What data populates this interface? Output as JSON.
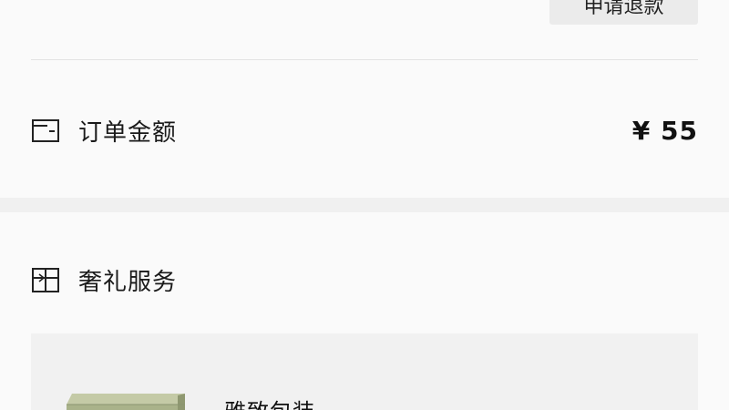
{
  "order": {
    "refund_button": "申请退款",
    "amount_label": "订单金额",
    "amount_value": "¥ 55"
  },
  "services": {
    "title": "奢礼服务",
    "items": [
      {
        "name": "雅致包装",
        "icon": "gift-box-image"
      }
    ]
  },
  "icons": {
    "amount": "wallet-icon",
    "services": "gift-icon"
  },
  "colors": {
    "background": "#f6f6f6",
    "card": "#fafafa",
    "panel": "#f1f1f1",
    "button": "#ebebeb",
    "text": "#1a1a1a",
    "gift_box": "#a9b28a"
  }
}
